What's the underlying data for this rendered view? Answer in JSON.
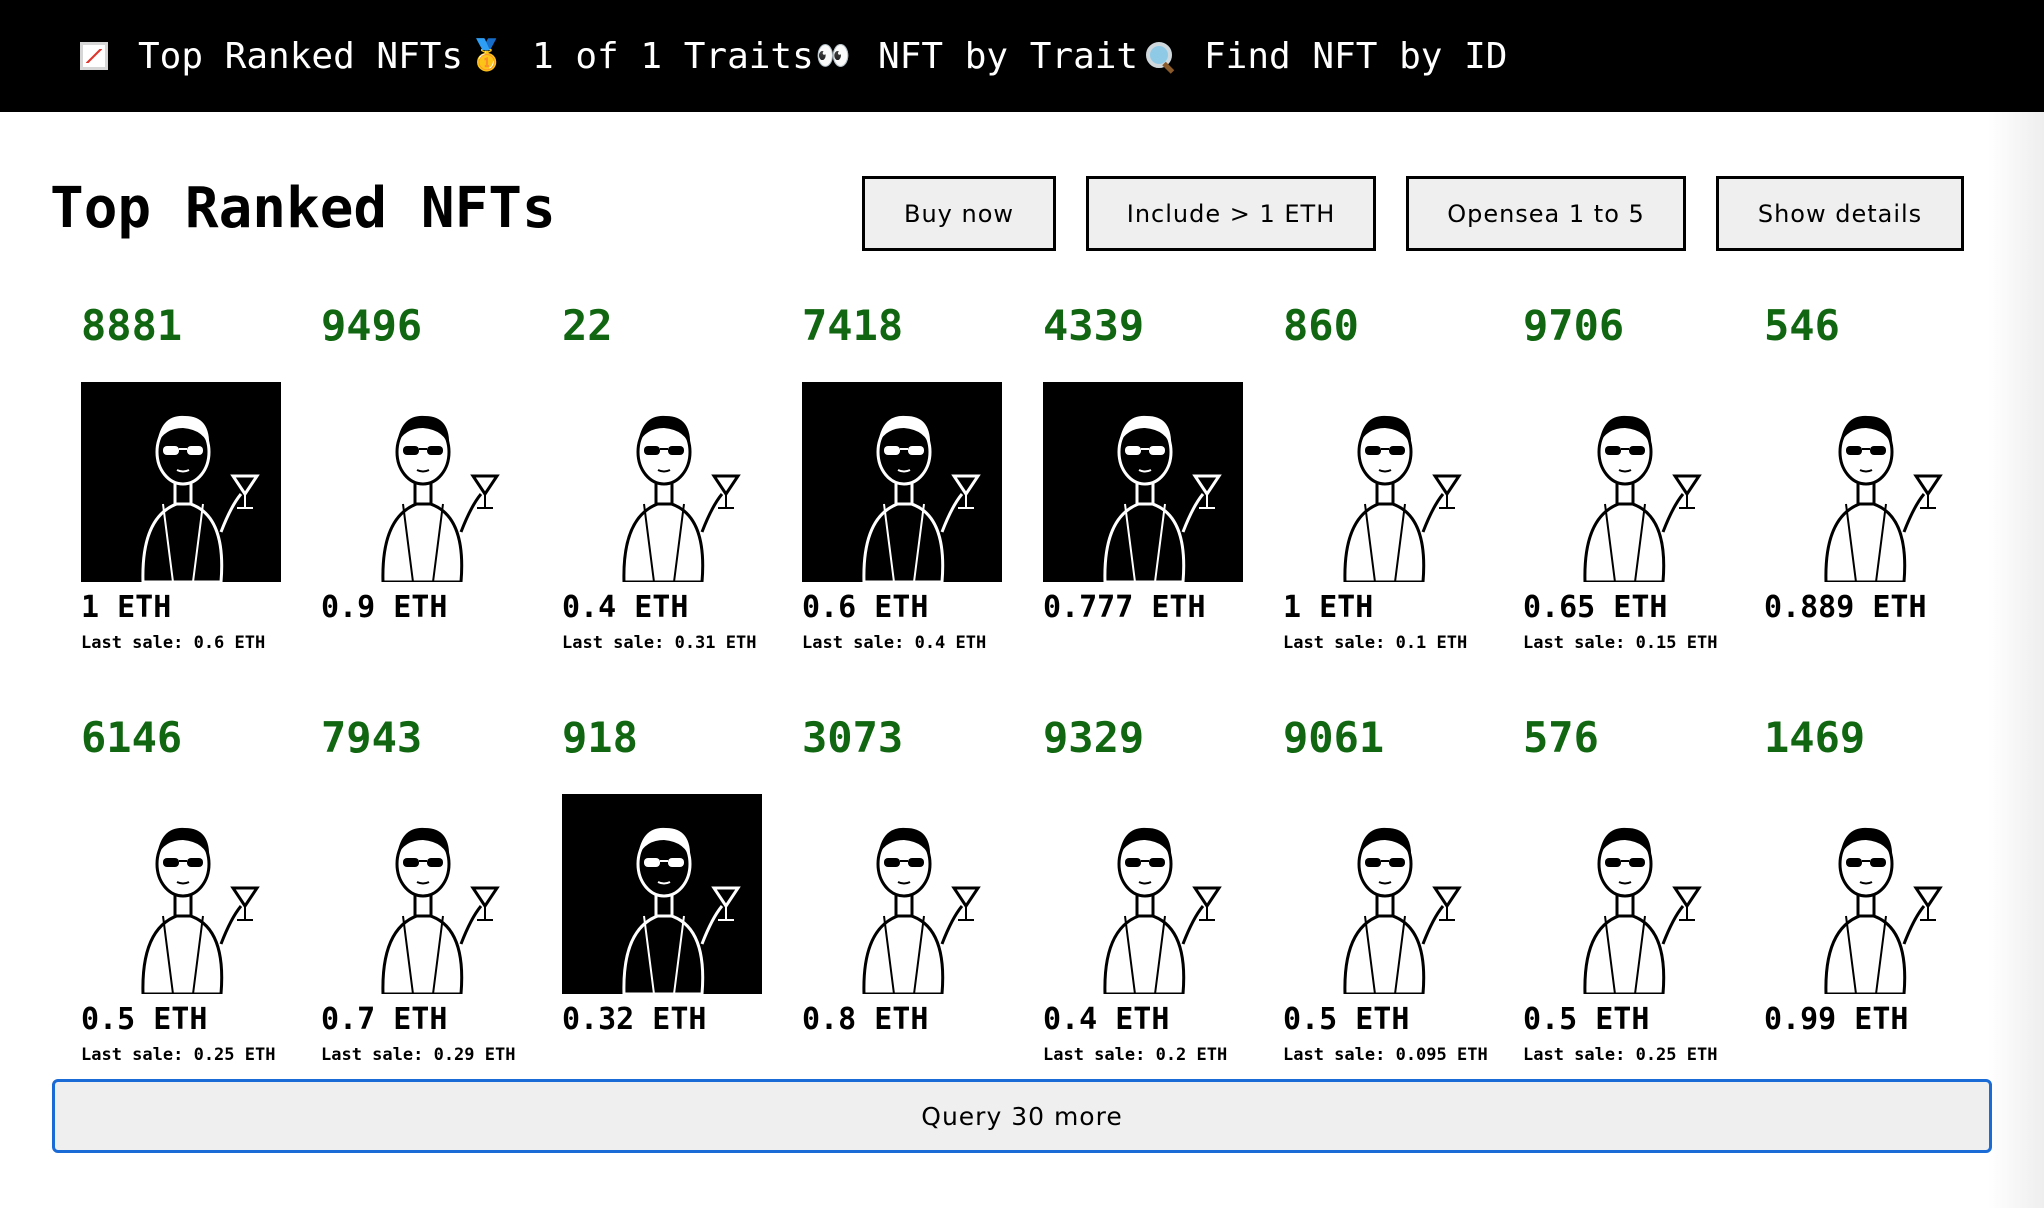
{
  "navbar": {
    "items": [
      {
        "label": "Top Ranked NFTs",
        "icon": "chart-increasing-icon"
      },
      {
        "label": "1 of 1 Traits",
        "icon": "medal-icon"
      },
      {
        "label": "NFT by Trait",
        "icon": "eyes-icon"
      },
      {
        "label": "Find NFT by ID",
        "icon": "magnifying-glass-icon"
      }
    ]
  },
  "page": {
    "title": "Top Ranked NFTs"
  },
  "toolbar": {
    "buy_now": "Buy now",
    "include_1_eth": "Include > 1 ETH",
    "opensea_1_to_5": "Opensea 1 to 5",
    "show_details": "Show details"
  },
  "nfts": [
    {
      "id": "8881",
      "price": "1 ETH",
      "last_sale": "Last sale: 0.6 ETH",
      "background": "dark"
    },
    {
      "id": "9496",
      "price": "0.9 ETH",
      "last_sale": "",
      "background": "light"
    },
    {
      "id": "22",
      "price": "0.4 ETH",
      "last_sale": "Last sale: 0.31 ETH",
      "background": "light"
    },
    {
      "id": "7418",
      "price": "0.6 ETH",
      "last_sale": "Last sale: 0.4 ETH",
      "background": "dark"
    },
    {
      "id": "4339",
      "price": "0.777 ETH",
      "last_sale": "",
      "background": "dark"
    },
    {
      "id": "860",
      "price": "1 ETH",
      "last_sale": "Last sale: 0.1 ETH",
      "background": "light"
    },
    {
      "id": "9706",
      "price": "0.65 ETH",
      "last_sale": "Last sale: 0.15 ETH",
      "background": "light"
    },
    {
      "id": "546",
      "price": "0.889 ETH",
      "last_sale": "",
      "background": "light"
    },
    {
      "id": "6146",
      "price": "0.5 ETH",
      "last_sale": "Last sale: 0.25 ETH",
      "background": "light"
    },
    {
      "id": "7943",
      "price": "0.7 ETH",
      "last_sale": "Last sale: 0.29 ETH",
      "background": "light"
    },
    {
      "id": "918",
      "price": "0.32 ETH",
      "last_sale": "",
      "background": "dark"
    },
    {
      "id": "3073",
      "price": "0.8 ETH",
      "last_sale": "",
      "background": "light"
    },
    {
      "id": "9329",
      "price": "0.4 ETH",
      "last_sale": "Last sale: 0.2 ETH",
      "background": "light"
    },
    {
      "id": "9061",
      "price": "0.5 ETH",
      "last_sale": "Last sale: 0.095 ETH",
      "background": "light"
    },
    {
      "id": "576",
      "price": "0.5 ETH",
      "last_sale": "Last sale: 0.25 ETH",
      "background": "light"
    },
    {
      "id": "1469",
      "price": "0.99 ETH",
      "last_sale": "",
      "background": "light"
    }
  ],
  "query_more": "Query 30 more",
  "colors": {
    "navbar_bg": "#000000",
    "id_green": "#116611",
    "button_bg": "#efefef",
    "query_border": "#1a6bd6"
  }
}
